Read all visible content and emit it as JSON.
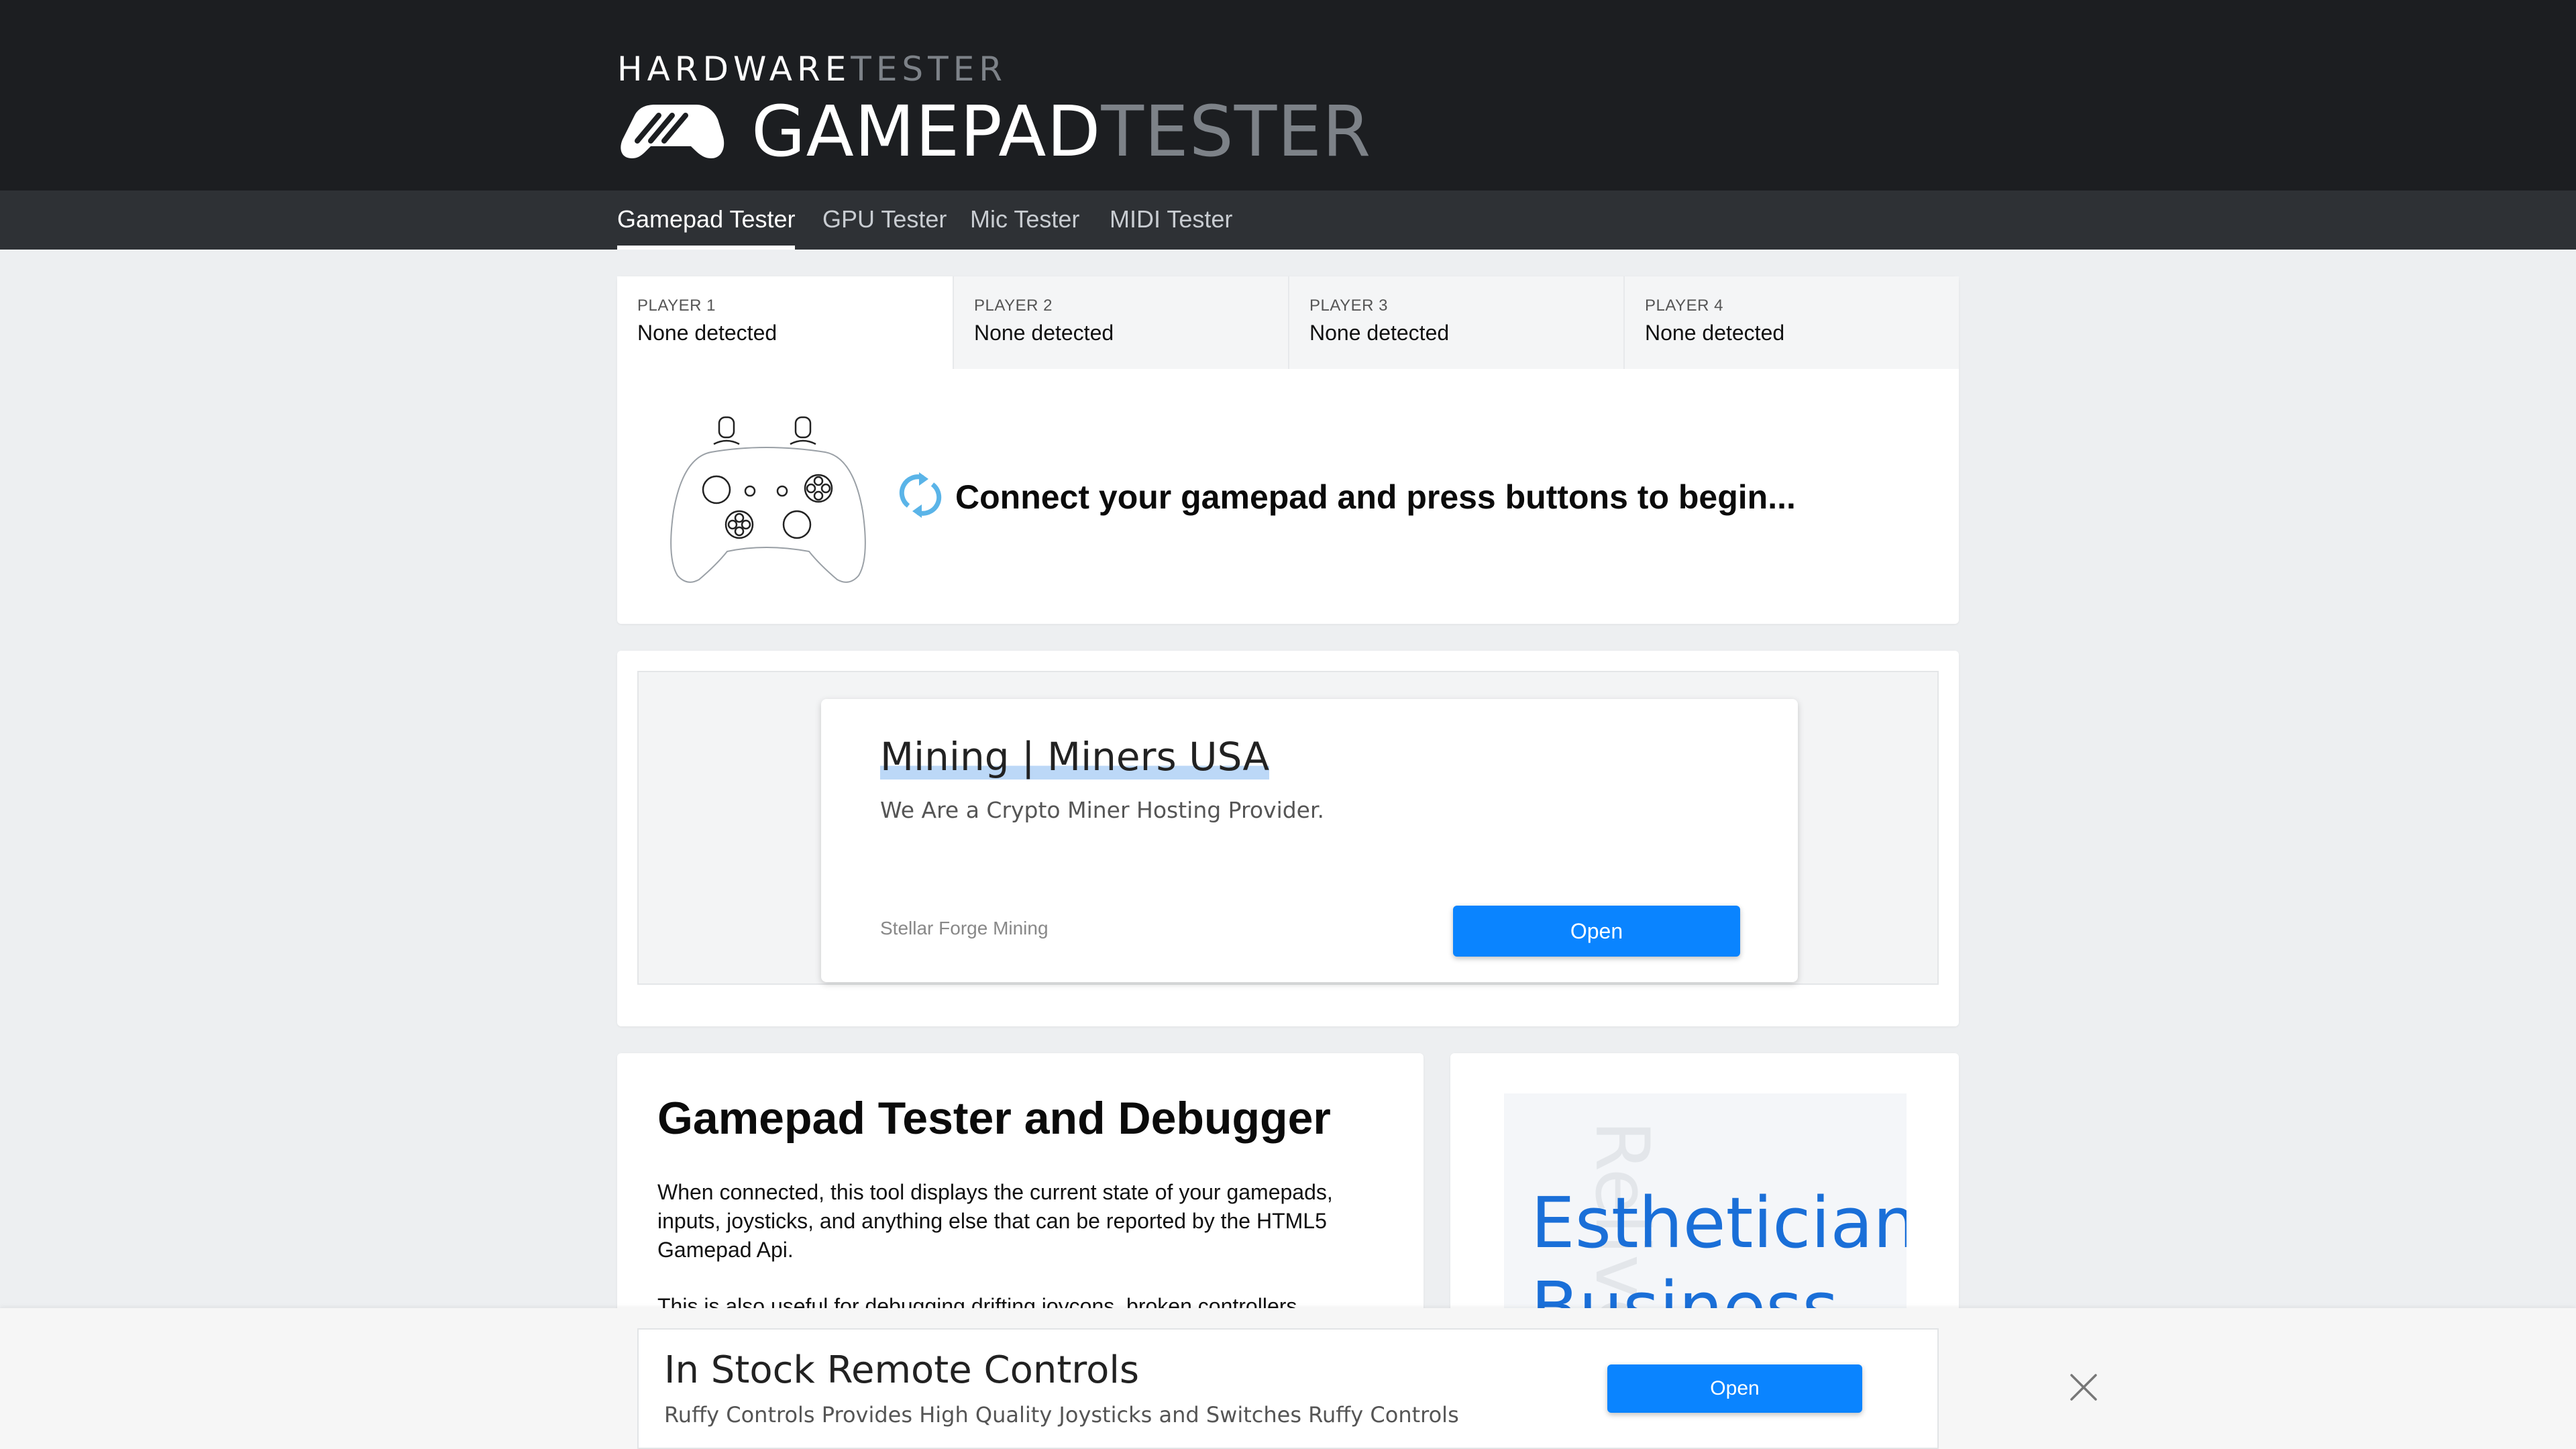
{
  "header": {
    "brand_small_a": "HARDWARE",
    "brand_small_b": "TESTER",
    "brand_big_a": "GAMEPAD",
    "brand_big_b": "TESTER",
    "logo_icon": "gamepad-logo-icon"
  },
  "nav": {
    "items": [
      {
        "label": "Gamepad Tester",
        "active": true
      },
      {
        "label": "GPU Tester",
        "active": false
      },
      {
        "label": "Mic Tester",
        "active": false
      },
      {
        "label": "MIDI Tester",
        "active": false
      }
    ]
  },
  "players": [
    {
      "title": "PLAYER 1",
      "status": "None detected"
    },
    {
      "title": "PLAYER 2",
      "status": "None detected"
    },
    {
      "title": "PLAYER 3",
      "status": "None detected"
    },
    {
      "title": "PLAYER 4",
      "status": "None detected"
    }
  ],
  "connect": {
    "message": "Connect your gamepad and press buttons to begin...",
    "icon": "refresh-icon",
    "icon_color": "#5ab4e8"
  },
  "ad_main": {
    "title": "Mining | Miners USA",
    "description": "We Are a Crypto Miner Hosting Provider.",
    "advertiser": "Stellar Forge Mining",
    "button": "Open",
    "button_color": "#0a84ff"
  },
  "info": {
    "title": "Gamepad Tester and Debugger",
    "p1": "When connected, this tool displays the current state of your gamepads, inputs, joysticks, and anything else that can be reported by the HTML5 Gamepad Api.",
    "p2": "This is also useful for debugging drifting joycons, broken controllers,"
  },
  "side_ad": {
    "text_line1": "Esthetician",
    "text_line2": "Business",
    "background_word": "Relive",
    "text_color": "#1a6fd8"
  },
  "bottom_ad": {
    "title": "In Stock Remote Controls",
    "description": "Ruffy Controls Provides High Quality Joysticks and Switches Ruffy Controls",
    "button": "Open",
    "close_icon": "close-icon"
  }
}
